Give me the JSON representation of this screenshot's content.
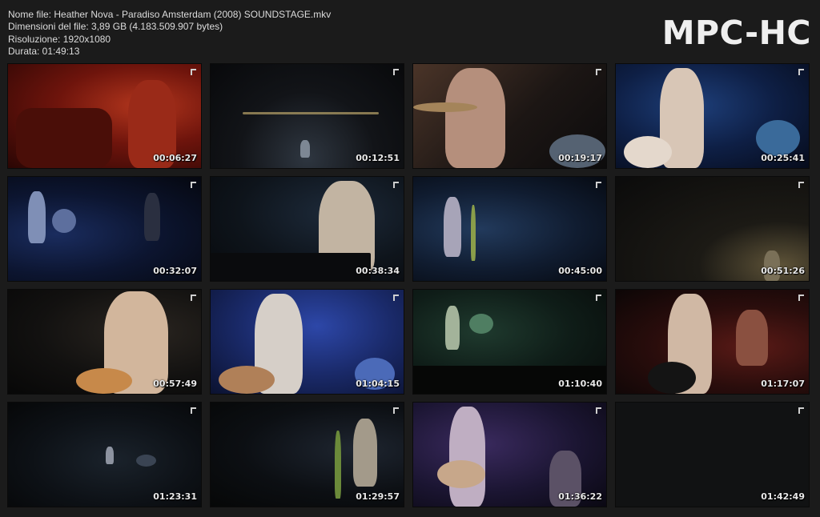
{
  "info": {
    "filename": "Nome file: Heather Nova - Paradiso Amsterdam (2008) SOUNDSTAGE.mkv",
    "filesize": "Dimensioni del file: 3,89 GB (4.183.509.907 bytes)",
    "resolution": "Risoluzione: 1920x1080",
    "duration": "Durata: 01:49:13"
  },
  "logo": "MPC-HC",
  "thumbnails": [
    {
      "time": "00:06:27",
      "scene": "drummer-red"
    },
    {
      "time": "00:12:51",
      "scene": "wide-stage-dark"
    },
    {
      "time": "00:19:17",
      "scene": "drummer-closeup"
    },
    {
      "time": "00:25:41",
      "scene": "singer-guitar-blue"
    },
    {
      "time": "00:32:07",
      "scene": "band-blue-wide"
    },
    {
      "time": "00:38:34",
      "scene": "singer-piano"
    },
    {
      "time": "00:45:00",
      "scene": "stage-blue-singer"
    },
    {
      "time": "00:51:26",
      "scene": "dark-spotlight"
    },
    {
      "time": "00:57:49",
      "scene": "singer-guitar-warm"
    },
    {
      "time": "01:04:15",
      "scene": "singer-guitar-blue-bright"
    },
    {
      "time": "01:10:40",
      "scene": "band-green-wide"
    },
    {
      "time": "01:17:07",
      "scene": "singer-drummer-red"
    },
    {
      "time": "01:23:31",
      "scene": "audience-wide"
    },
    {
      "time": "01:29:57",
      "scene": "singer-dark-stage"
    },
    {
      "time": "01:36:22",
      "scene": "singer-purple"
    },
    {
      "time": "01:42:49",
      "scene": "black-frame"
    }
  ]
}
